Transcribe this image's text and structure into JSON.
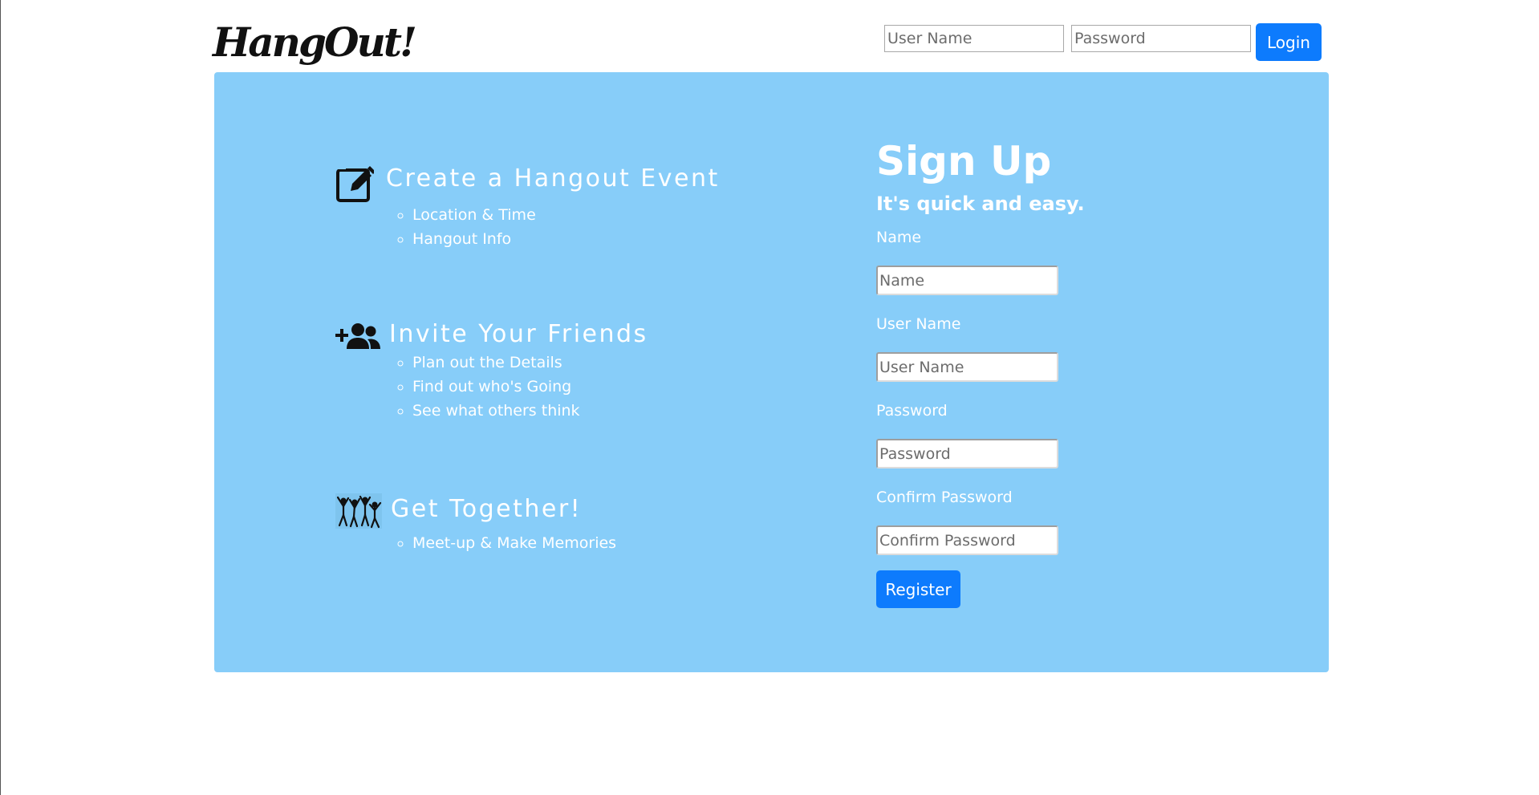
{
  "brand": {
    "logo_text": "HangOut!"
  },
  "header": {
    "username_placeholder": "User Name",
    "password_placeholder": "Password",
    "login_label": "Login"
  },
  "features": [
    {
      "icon": "edit-square-icon",
      "title": "Create a Hangout Event",
      "items": [
        "Location & Time",
        "Hangout Info"
      ]
    },
    {
      "icon": "add-friends-icon",
      "title": "Invite Your Friends",
      "items": [
        "Plan out the Details",
        "Find out who's Going",
        "See what others think"
      ]
    },
    {
      "icon": "people-celebrating-icon",
      "title": "Get Together!",
      "items": [
        "Meet-up & Make Memories"
      ]
    }
  ],
  "signup": {
    "title": "Sign Up",
    "subtitle": "It's quick and easy.",
    "fields": [
      {
        "label": "Name",
        "placeholder": "Name"
      },
      {
        "label": "User Name",
        "placeholder": "User Name"
      },
      {
        "label": "Password",
        "placeholder": "Password"
      },
      {
        "label": "Confirm Password",
        "placeholder": "Confirm Password"
      }
    ],
    "register_label": "Register"
  },
  "colors": {
    "hero_background": "#87cdf9",
    "button_primary": "#0d7bfd",
    "text_on_hero": "#ffffff"
  }
}
